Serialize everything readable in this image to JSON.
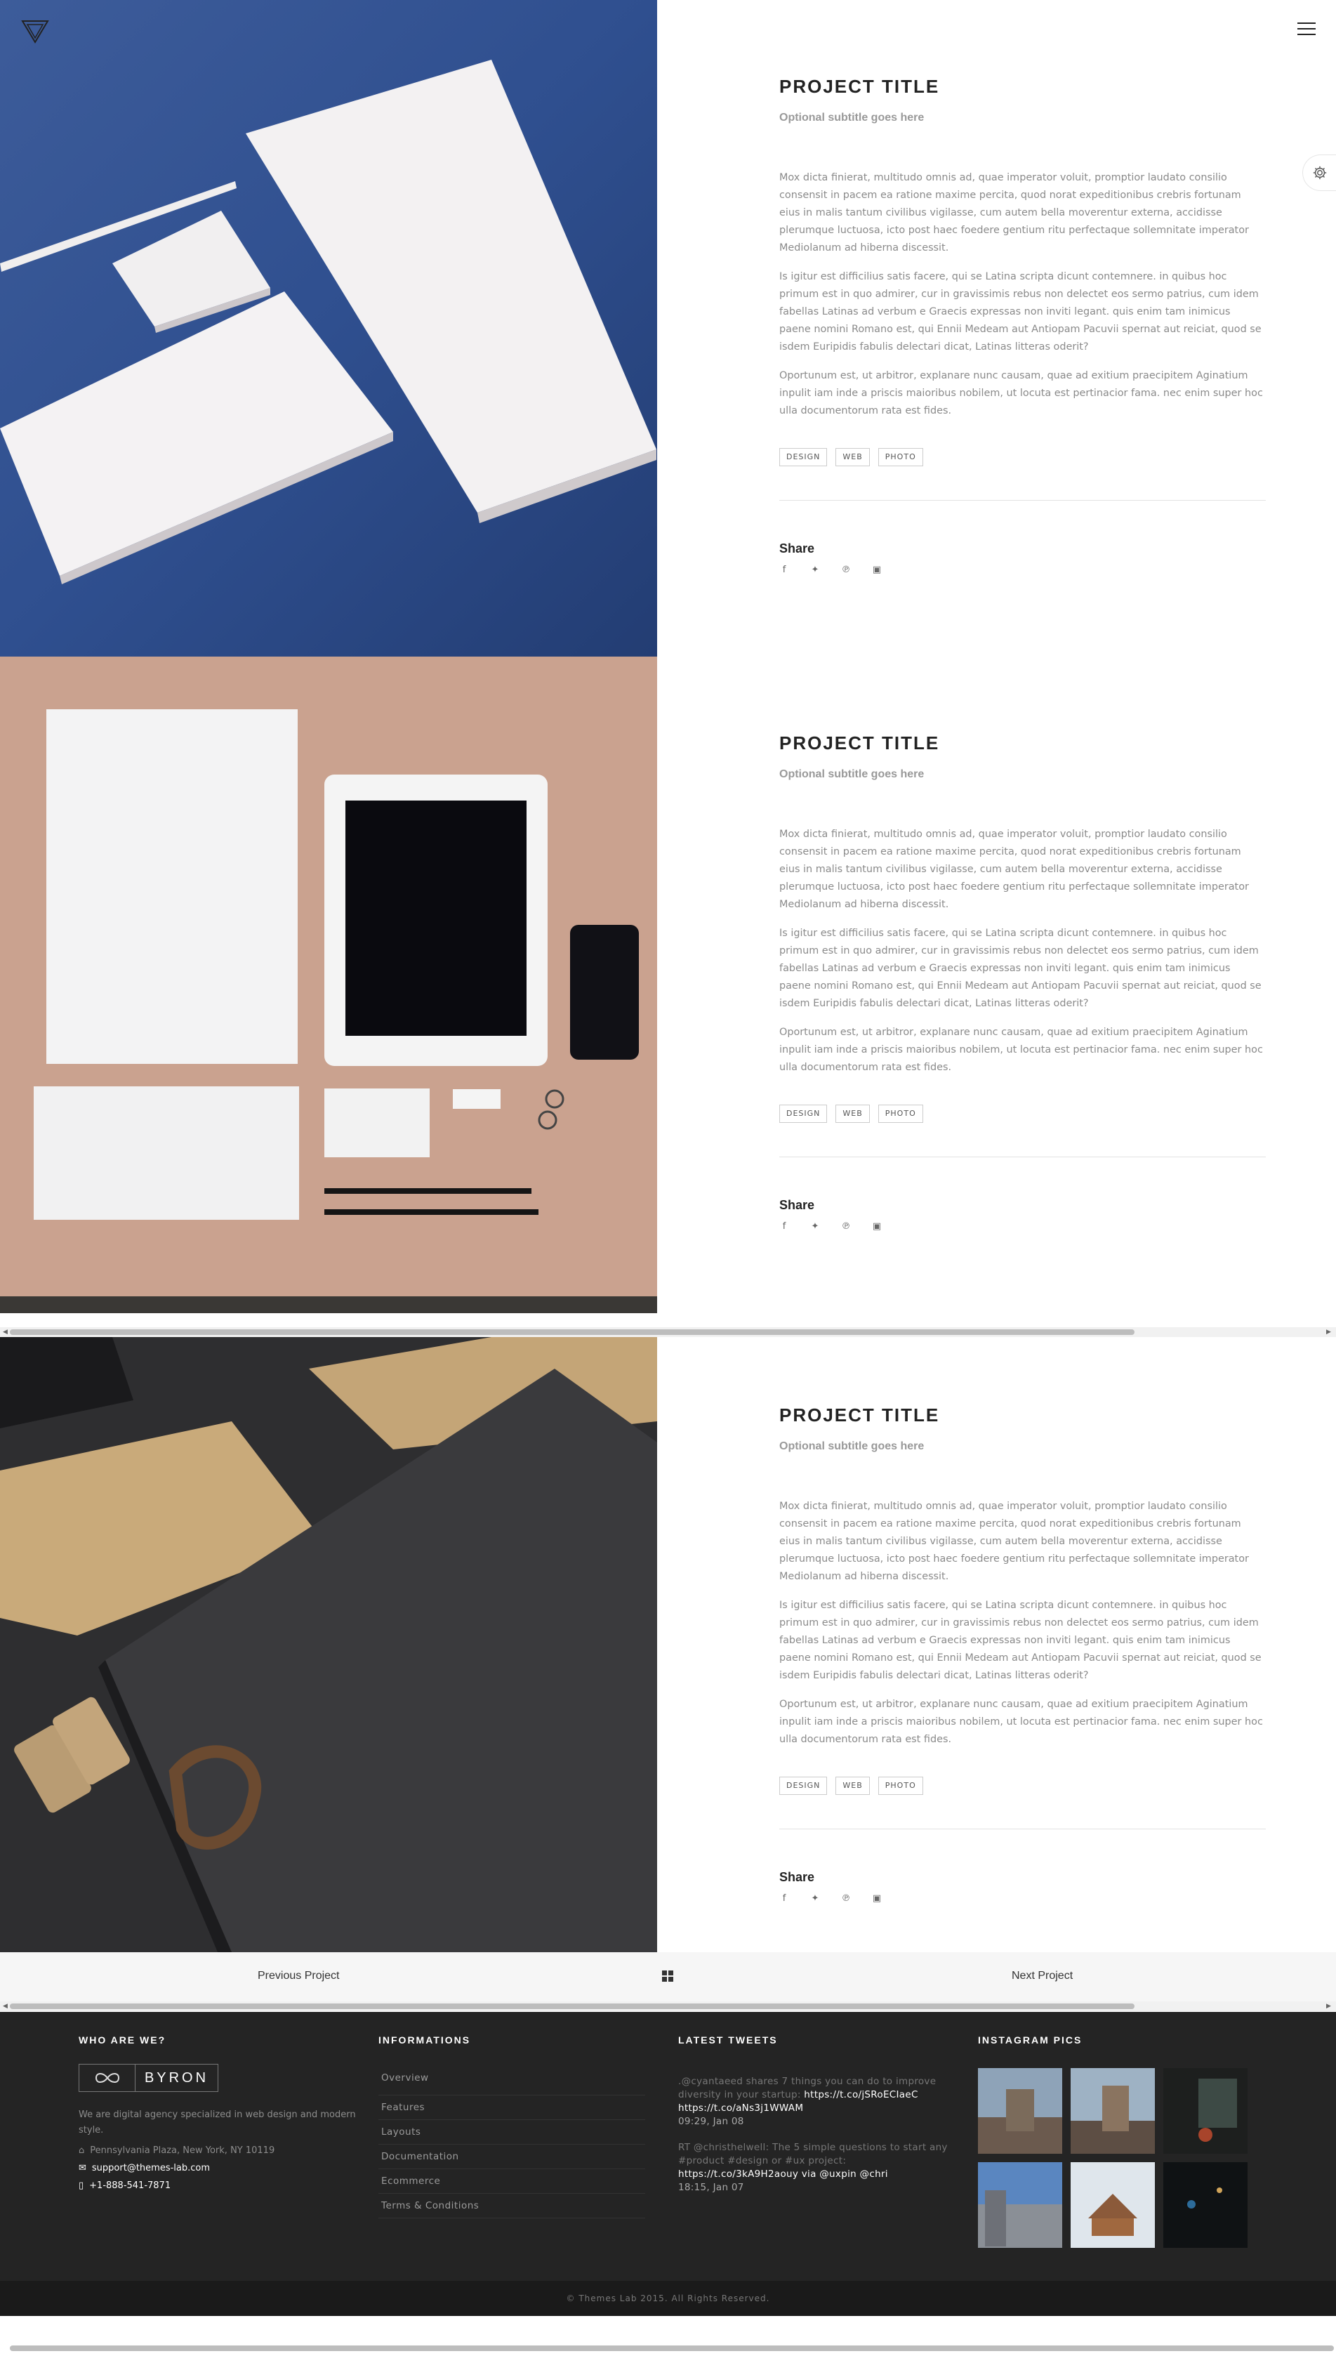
{
  "header": {
    "logo_icon": "triangle-logo-icon",
    "menu_icon": "hamburger-icon",
    "settings_icon": "gear-icon"
  },
  "projects": [
    {
      "title": "PROJECT TITLE",
      "subtitle": "Optional subtitle goes here",
      "paragraphs": [
        "Mox dicta finierat, multitudo omnis ad, quae imperator voluit, promptior laudato consilio consensit in pacem ea ratione maxime percita, quod norat expeditionibus crebris fortunam eius in malis tantum civilibus vigilasse, cum autem bella moverentur externa, accidisse plerumque luctuosa, icto post haec foedere gentium ritu perfectaque sollemnitate imperator Mediolanum ad hiberna discessit.",
        "Is igitur est difficilius satis facere, qui se Latina scripta dicunt contemnere. in quibus hoc primum est in quo admirer, cur in gravissimis rebus non delectet eos sermo patrius, cum idem fabellas Latinas ad verbum e Graecis expressas non inviti legant. quis enim tam inimicus paene nomini Romano est, qui Ennii Medeam aut Antiopam Pacuvii spernat aut reiciat, quod se isdem Euripidis fabulis delectari dicat, Latinas litteras oderit?",
        "Oportunum est, ut arbitror, explanare nunc causam, quae ad exitium praecipitem Aginatium inpulit iam inde a priscis maioribus nobilem, ut locuta est pertinacior fama. nec enim super hoc ulla documentorum rata est fides."
      ],
      "tags": [
        "DESIGN",
        "WEB",
        "PHOTO"
      ],
      "share_label": "Share"
    },
    {
      "title": "PROJECT TITLE",
      "subtitle": "Optional subtitle goes here",
      "paragraphs": [
        "Mox dicta finierat, multitudo omnis ad, quae imperator voluit, promptior laudato consilio consensit in pacem ea ratione maxime percita, quod norat expeditionibus crebris fortunam eius in malis tantum civilibus vigilasse, cum autem bella moverentur externa, accidisse plerumque luctuosa, icto post haec foedere gentium ritu perfectaque sollemnitate imperator Mediolanum ad hiberna discessit.",
        "Is igitur est difficilius satis facere, qui se Latina scripta dicunt contemnere. in quibus hoc primum est in quo admirer, cur in gravissimis rebus non delectet eos sermo patrius, cum idem fabellas Latinas ad verbum e Graecis expressas non inviti legant. quis enim tam inimicus paene nomini Romano est, qui Ennii Medeam aut Antiopam Pacuvii spernat aut reiciat, quod se isdem Euripidis fabulis delectari dicat, Latinas litteras oderit?",
        "Oportunum est, ut arbitror, explanare nunc causam, quae ad exitium praecipitem Aginatium inpulit iam inde a priscis maioribus nobilem, ut locuta est pertinacior fama. nec enim super hoc ulla documentorum rata est fides."
      ],
      "tags": [
        "DESIGN",
        "WEB",
        "PHOTO"
      ],
      "share_label": "Share"
    },
    {
      "title": "PROJECT TITLE",
      "subtitle": "Optional subtitle goes here",
      "paragraphs": [
        "Mox dicta finierat, multitudo omnis ad, quae imperator voluit, promptior laudato consilio consensit in pacem ea ratione maxime percita, quod norat expeditionibus crebris fortunam eius in malis tantum civilibus vigilasse, cum autem bella moverentur externa, accidisse plerumque luctuosa, icto post haec foedere gentium ritu perfectaque sollemnitate imperator Mediolanum ad hiberna discessit.",
        "Is igitur est difficilius satis facere, qui se Latina scripta dicunt contemnere. in quibus hoc primum est in quo admirer, cur in gravissimis rebus non delectet eos sermo patrius, cum idem fabellas Latinas ad verbum e Graecis expressas non inviti legant. quis enim tam inimicus paene nomini Romano est, qui Ennii Medeam aut Antiopam Pacuvii spernat aut reiciat, quod se isdem Euripidis fabulis delectari dicat, Latinas litteras oderit?",
        "Oportunum est, ut arbitror, explanare nunc causam, quae ad exitium praecipitem Aginatium inpulit iam inde a priscis maioribus nobilem, ut locuta est pertinacior fama. nec enim super hoc ulla documentorum rata est fides."
      ],
      "tags": [
        "DESIGN",
        "WEB",
        "PHOTO"
      ],
      "share_label": "Share"
    }
  ],
  "share_icons": [
    "facebook-icon",
    "twitter-icon",
    "pinterest-icon",
    "instagram-icon"
  ],
  "pager": {
    "prev_label": "Previous Project",
    "next_label": "Next Project",
    "grid_icon": "grid-icon"
  },
  "footer": {
    "who": {
      "heading": "WHO ARE WE?",
      "brand_name": "BYRON",
      "about": "We are digital agency specialized in web design and modern style.",
      "address": "Pennsylvania Plaza, New York, NY 10119",
      "email": "support@themes-lab.com",
      "phone": "+1-888-541-7871"
    },
    "info": {
      "heading": "INFORMATIONS",
      "links": [
        "Overview",
        "Features",
        "Layouts",
        "Documentation",
        "Ecommerce",
        "Terms & Conditions"
      ]
    },
    "tweets": {
      "heading": "LATEST TWEETS",
      "items": [
        {
          "text": ".@cyantaeed shares 7 things you can do to improve diversity in your startup: ",
          "link1": "https://t.co/jSRoECIaeC",
          "link2": "https://t.co/aNs3j1WWAM",
          "time": "09:29, Jan 08"
        },
        {
          "text": "RT @christhelwell: The 5 simple questions to start any #product #design or #ux project: ",
          "link1": "https://t.co/3kA9H2aouy via @uxpin @chri",
          "link2": "",
          "time": "18:15, Jan 07"
        }
      ]
    },
    "instagram": {
      "heading": "INSTAGRAM PICS"
    },
    "copyright": "© Themes Lab 2015. All Rights Reserved."
  }
}
